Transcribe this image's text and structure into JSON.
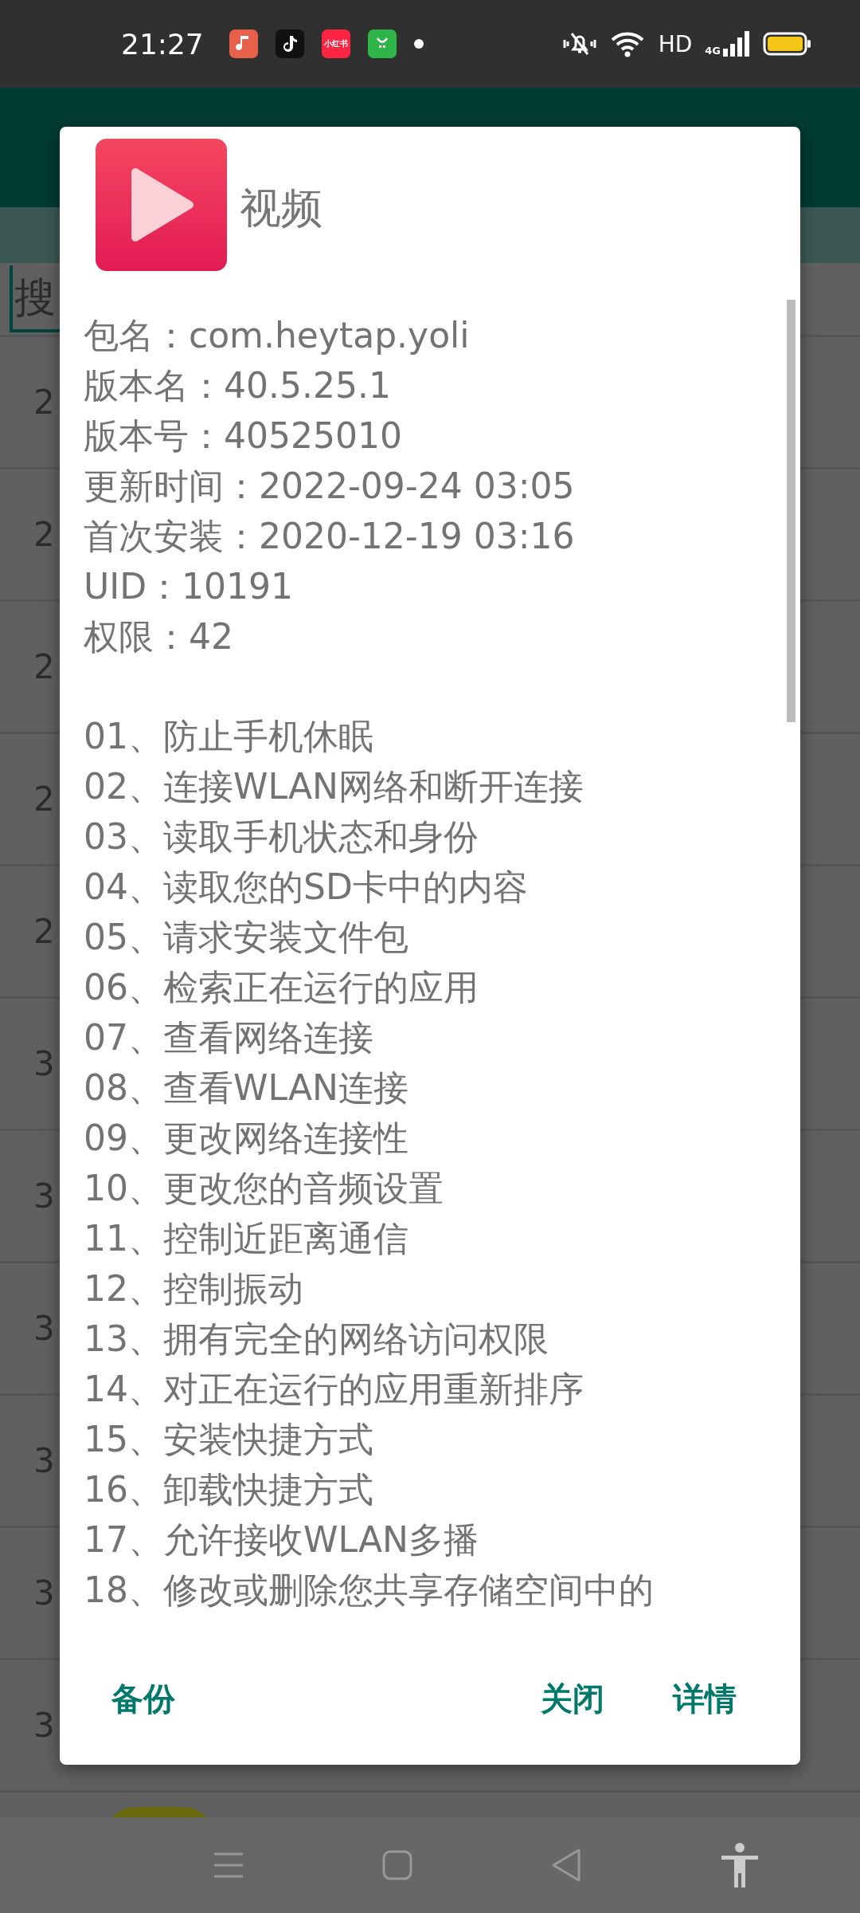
{
  "status_bar": {
    "time": "21:27",
    "app_badge": "小红书",
    "network": "HD",
    "signal": "4G"
  },
  "search": {
    "placeholder": "搜"
  },
  "rows": [
    "2",
    "2",
    "2",
    "2",
    "2",
    "3",
    "3",
    "3",
    "3",
    "3",
    "3"
  ],
  "dialog": {
    "title": "视频",
    "info": [
      "包名：com.heytap.yoli",
      "版本名：40.5.25.1",
      "版本号：40525010",
      "更新时间：2022-09-24 03:05",
      "首次安装：2020-12-19 03:16",
      "UID：10191",
      "权限：42"
    ],
    "permissions": [
      "01、防止手机休眠",
      "02、连接WLAN网络和断开连接",
      "03、读取手机状态和身份",
      "04、读取您的SD卡中的内容",
      "05、请求安装文件包",
      "06、检索正在运行的应用",
      "07、查看网络连接",
      "08、查看WLAN连接",
      "09、更改网络连接性",
      "10、更改您的音频设置",
      "11、控制近距离通信",
      "12、控制振动",
      "13、拥有完全的网络访问权限",
      "14、对正在运行的应用重新排序",
      "15、安装快捷方式",
      "16、卸载快捷方式",
      "17、允许接收WLAN多播",
      "18、修改或删除您共享存储空间中的"
    ],
    "buttons": {
      "left": "备份",
      "middle": "关闭",
      "right": "详情"
    }
  }
}
